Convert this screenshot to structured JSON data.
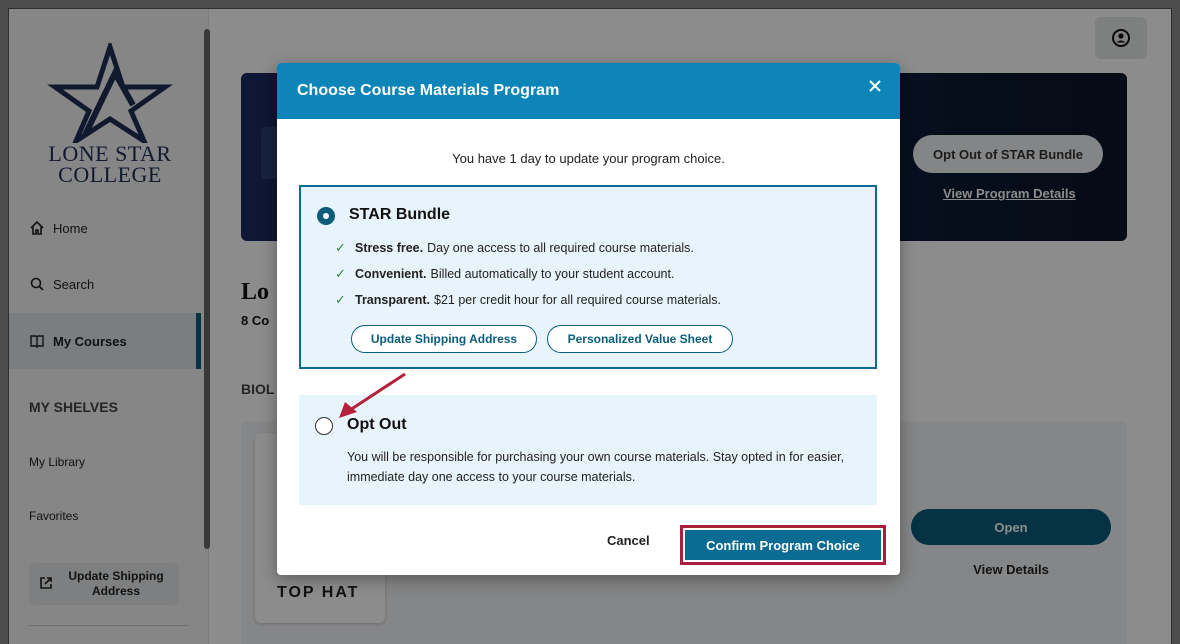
{
  "sidebar": {
    "logo_line1": "LONE STAR",
    "logo_line2": "COLLEGE",
    "nav": [
      {
        "label": "Home",
        "icon": "home-icon"
      },
      {
        "label": "Search",
        "icon": "search-icon"
      },
      {
        "label": "My Courses",
        "icon": "book-icon"
      }
    ],
    "shelves_title": "MY SHELVES",
    "shelves": [
      "My Library",
      "Favorites"
    ],
    "shipping_button": "Update Shipping Address"
  },
  "banner": {
    "opt_out_button": "Opt Out of STAR Bundle",
    "details_link": "View Program Details"
  },
  "page": {
    "title_partial": "Lo",
    "subtitle_partial": "8 Co",
    "section_partial": "BIOL",
    "course_brand": "TOP HAT",
    "open_button": "Open",
    "view_details": "View Details"
  },
  "modal": {
    "title": "Choose Course Materials Program",
    "notice": "You have 1 day to update your program choice.",
    "option_bundle": {
      "title": "STAR Bundle",
      "selected": true,
      "features": [
        {
          "bold": "Stress free.",
          "text": "Day one access to all required course materials."
        },
        {
          "bold": "Convenient.",
          "text": "Billed automatically to your student account."
        },
        {
          "bold": "Transparent.",
          "text": "$21 per credit hour for all required course materials."
        }
      ],
      "buttons": [
        "Update Shipping Address",
        "Personalized Value Sheet"
      ]
    },
    "option_optout": {
      "title": "Opt Out",
      "selected": false,
      "description": "You will be responsible for purchasing your own course materials. Stay opted in for easier, immediate day one access to your course materials."
    },
    "cancel_label": "Cancel",
    "confirm_label": "Confirm Program Choice"
  },
  "colors": {
    "header": "#0e85b8",
    "primary": "#0b5d7c",
    "highlight": "#a8203d",
    "annotation_arrow": "#b5203a"
  }
}
